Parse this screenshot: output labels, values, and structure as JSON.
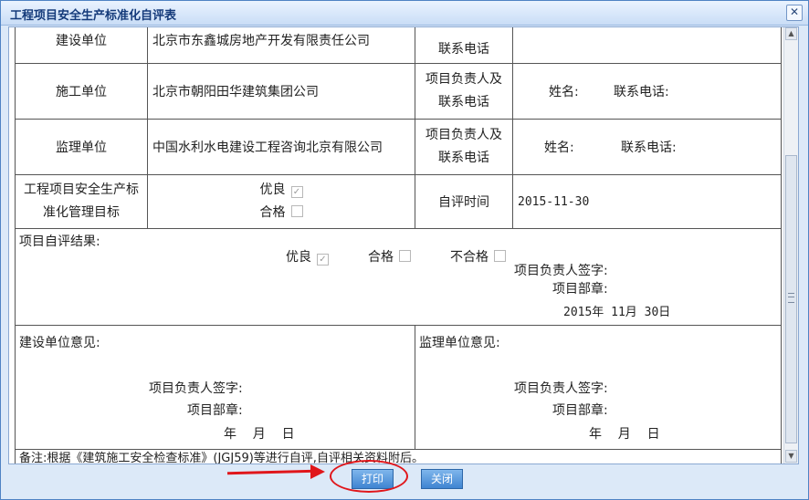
{
  "window": {
    "title": "工程项目安全生产标准化自评表",
    "close_glyph": "✕"
  },
  "rows": {
    "jianshe": {
      "label": "建设单位",
      "company": "北京市东鑫城房地产开发有限责任公司",
      "contact_tail": "联系电话"
    },
    "shigong": {
      "label": "施工单位",
      "company": "北京市朝阳田华建筑集团公司",
      "person_label_line1": "项目负责人及",
      "person_label_line2": "联系电话",
      "name_label": "姓名:",
      "phone_label": "联系电话:"
    },
    "jianli": {
      "label": "监理单位",
      "company": "中国水利水电建设工程咨询北京有限公司",
      "person_label_line1": "项目负责人及",
      "person_label_line2": "联系电话",
      "name_label": "姓名:",
      "phone_label": "联系电话:"
    },
    "target": {
      "label_line1": "工程项目安全生产标",
      "label_line2": "准化管理目标",
      "option_excellent": "优良",
      "option_pass": "合格",
      "excellent_checked": true,
      "pass_checked": false,
      "time_label": "自评时间",
      "time_value": "2015-11-30"
    }
  },
  "self_eval": {
    "label": "项目自评结果:",
    "option_excellent": "优良",
    "option_pass": "合格",
    "option_fail": "不合格",
    "excellent_checked": true,
    "pass_checked": false,
    "fail_checked": false,
    "signature_label": "项目负责人签字:",
    "seal_label": "项目部章:",
    "date_text": "2015年 11月 30日"
  },
  "opinions": {
    "jianshe_label": "建设单位意见:",
    "jianli_label": "监理单位意见:",
    "signature_label": "项目负责人签字:",
    "seal_label": "项目部章:",
    "date_text": "年    月    日"
  },
  "note": "备注:根据《建筑施工安全检查标准》(JGJ59)等进行自评,自评相关资料附后。",
  "buttons": {
    "print": "打印",
    "close": "关闭"
  },
  "colors": {
    "annotation": "#e0161b",
    "button": "#3f84d1",
    "title_text": "#143a7a"
  },
  "checkmark": "✓"
}
